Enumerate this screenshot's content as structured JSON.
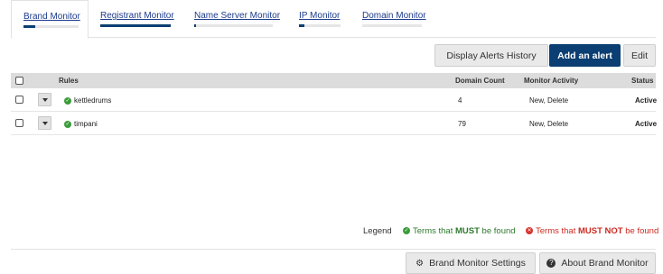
{
  "tabs": [
    {
      "label": "Brand Monitor",
      "progress": 0.22,
      "active": true
    },
    {
      "label": "Registrant Monitor",
      "progress": 1.0,
      "active": false
    },
    {
      "label": "Name Server Monitor",
      "progress": 0.02,
      "active": false
    },
    {
      "label": "IP Monitor",
      "progress": 0.12,
      "active": false
    },
    {
      "label": "Domain Monitor",
      "progress": 0.0,
      "active": false
    }
  ],
  "actions": {
    "history_label": "Display Alerts History",
    "add_label": "Add an alert",
    "edit_label": "Edit"
  },
  "table": {
    "headers": {
      "rules": "Rules",
      "domain_count": "Domain Count",
      "monitor_activity": "Monitor Activity",
      "status": "Status"
    },
    "rows": [
      {
        "rule": "kettledrums",
        "domain_count": "4",
        "activity": "New, Delete",
        "status": "Active"
      },
      {
        "rule": "timpani",
        "domain_count": "79",
        "activity": "New, Delete",
        "status": "Active"
      }
    ]
  },
  "legend": {
    "label": "Legend",
    "must_prefix": "Terms that ",
    "must_bold": "MUST",
    "must_suffix": " be found",
    "mustnot_prefix": "Terms that ",
    "mustnot_bold": "MUST NOT",
    "mustnot_suffix": " be found"
  },
  "footer": {
    "settings_label": "Brand Monitor Settings",
    "about_label": "About Brand Monitor"
  },
  "icons": {
    "must": "check-circle-icon",
    "mustnot": "x-circle-icon",
    "settings": "gear-icon",
    "about": "question-circle-icon"
  },
  "colors": {
    "primary": "#0b3e72",
    "must": "#2d7a2d",
    "mustnot": "#cc2a22"
  }
}
